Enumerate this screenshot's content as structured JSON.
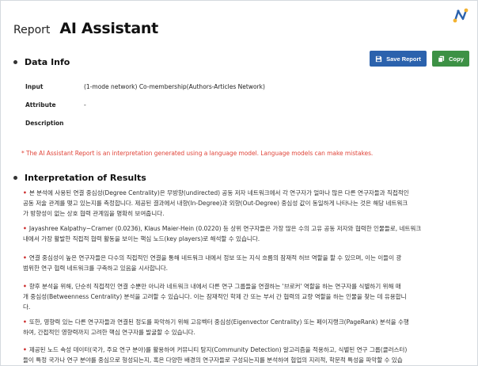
{
  "header": {
    "report_label": "Report",
    "title": "AI Assistant"
  },
  "data_info": {
    "heading": "Data Info",
    "rows": [
      {
        "label": "Input",
        "value": "(1-mode network) Co-membership(Authors-Articles Network)"
      },
      {
        "label": "Attribute",
        "value": "-"
      },
      {
        "label": "Description",
        "value": ""
      }
    ]
  },
  "toolbar": {
    "save_label": "Save Report",
    "copy_label": "Copy",
    "save_color": "#2b62ad",
    "copy_color": "#3d9145"
  },
  "notice": "* The AI Assistant Report is an interpretation generated using a language model. Language models can make mistakes.",
  "interpretation": {
    "heading": "Interpretation of Results",
    "paragraphs": [
      {
        "lines": [
          "본 분석에 사용된 연결 중심성(Degree Centrality)은 무방향(undirected) 공동 저자 네트워크에서 각 연구자가 얼마나 많은 다른 연구자들과 직접적인",
          "공동 저술 관계를 맺고 있는지를 측정합니다. 제공된 결과에서 내향(In-Degree)과 외향(Out-Degree) 중심성 값이 동일하게 나타나는 것은 해당 네트워크",
          "가 방향성이 없는 상호 협력 관계임을 명확히 보여줍니다."
        ]
      },
      {
        "lines": [
          "Jayashree Kalpathy−Cramer (0.0236), Klaus Maier-Hein (0.0220) 등 상위 연구자들은 가장 많은 수의 고유 공동 저자와 협력한 인물들로, 네트워크",
          "내에서 가장 활발한 직접적 협력 활동을 보이는 핵심 노드(key players)로 해석할 수 있습니다."
        ]
      },
      {
        "lines": [
          "연결 중심성이 높은 연구자들은 다수의 직접적인 연결을 통해 네트워크 내에서 정보 또는 지식 흐름의 잠재적 허브 역할을 할 수 있으며, 이는 이들이 광",
          "범위한 연구 협력 네트워크를 구축하고 있음을 시사합니다."
        ]
      },
      {
        "lines": [
          "향후 분석을 위해, 단순히 직접적인 연결 수뿐만 아니라 네트워크 내에서 다른 연구 그룹들을 연결하는 '브로커' 역할을 하는 연구자를 식별하기 위해 매",
          "개 중심성(Betweenness Centrality) 분석을 고려할 수 있습니다. 이는 잠재적인 학제 간 또는 부서 간 협력의 교량 역할을 하는 인물을 찾는 데 유용합니",
          "다."
        ]
      },
      {
        "lines": [
          "또한, 영향력 있는 다른 연구자들과 연결된 정도를 파악하기 위해 고유벡터 중심성(Eigenvector Centrality) 또는 페이지랭크(PageRank) 분석을 수행",
          "하여, 간접적인 영향력까지 고려한 핵심 연구자를 발굴할 수 있습니다."
        ]
      },
      {
        "lines": [
          "제공된 노드 속성 데이터(국가, 주요 연구 분야)를 활용하여 커뮤니티 탐지(Community Detection) 알고리즘을 적용하고, 식별된 연구 그룹(클러스터)",
          "들이 특정 국가나 연구 분야를 중심으로 형성되는지, 혹은 다양한 배경의 연구자들로 구성되는지를 분석하여 협업의 지리적, 학문적 특성을 파악할 수 있습"
        ]
      }
    ]
  },
  "icons": {
    "logo": "brand-logo-icon",
    "save": "save-icon",
    "copy": "copy-icon"
  }
}
